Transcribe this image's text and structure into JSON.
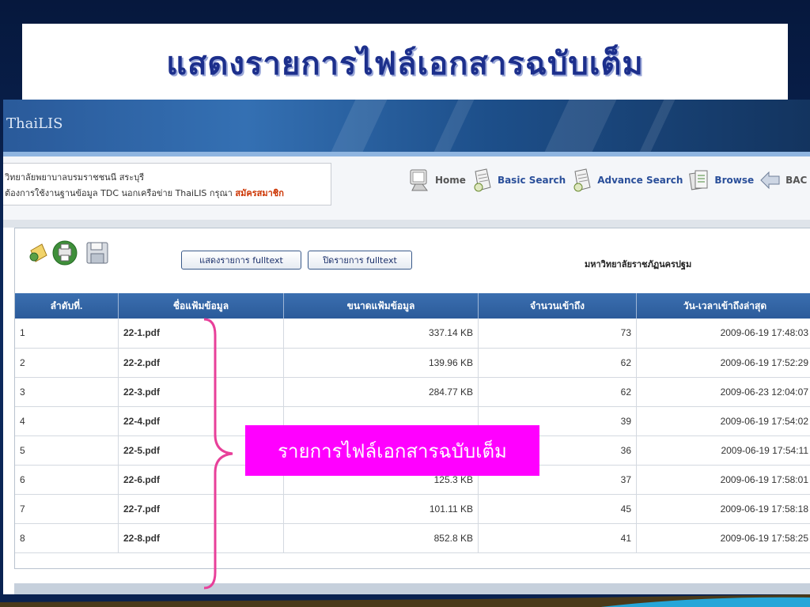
{
  "slide": {
    "title": "แสดงรายการไฟล์เอกสารฉบับเต็ม",
    "callout": "รายการไฟล์เอกสารฉบับเต็ม"
  },
  "app": {
    "brand": "ThaiLIS",
    "institution_line": "วิทยาลัยพยาบาลบรมราชชนนี สระบุรี",
    "notice_prefix": "ต้องการใช้งานฐานข้อมูล TDC นอกเครือข่าย ThaiLIS กรุณา",
    "notice_link": "สมัครสมาชิก",
    "nav": [
      {
        "label": "Home",
        "icon": "monitor-icon"
      },
      {
        "label": "Basic Search",
        "icon": "document-search-icon"
      },
      {
        "label": "Advance Search",
        "icon": "document-search-icon"
      },
      {
        "label": "Browse",
        "icon": "documents-icon"
      },
      {
        "label": "BAC",
        "icon": "back-arrow-icon"
      }
    ]
  },
  "toolbar": {
    "show_fulltext": "แสดงรายการ fulltext",
    "hide_fulltext": "ปิดรายการ fulltext",
    "university": "มหาวิทยาลัยราชภัฏนครปฐม"
  },
  "table": {
    "headers": [
      "ลำดับที่.",
      "ชื่อแฟ้มข้อมูล",
      "ขนาดแฟ้มข้อมูล",
      "จำนวนเข้าถึง",
      "วัน-เวลาเข้าถึงล่าสุด"
    ],
    "rows": [
      {
        "no": "1",
        "name": "22-1.pdf",
        "size": "337.14 KB",
        "hits": "73",
        "date": "2009-06-19 17:48:03"
      },
      {
        "no": "2",
        "name": "22-2.pdf",
        "size": "139.96 KB",
        "hits": "62",
        "date": "2009-06-19 17:52:29"
      },
      {
        "no": "3",
        "name": "22-3.pdf",
        "size": "284.77 KB",
        "hits": "62",
        "date": "2009-06-23 12:04:07"
      },
      {
        "no": "4",
        "name": "22-4.pdf",
        "size": "",
        "hits": "39",
        "date": "2009-06-19 17:54:02"
      },
      {
        "no": "5",
        "name": "22-5.pdf",
        "size": "",
        "hits": "36",
        "date": "2009-06-19 17:54:11"
      },
      {
        "no": "6",
        "name": "22-6.pdf",
        "size": "125.3 KB",
        "hits": "37",
        "date": "2009-06-19 17:58:01"
      },
      {
        "no": "7",
        "name": "22-7.pdf",
        "size": "101.11 KB",
        "hits": "45",
        "date": "2009-06-19 17:58:18"
      },
      {
        "no": "8",
        "name": "22-8.pdf",
        "size": "852.8 KB",
        "hits": "41",
        "date": "2009-06-19 17:58:25"
      }
    ]
  },
  "colors": {
    "title": "#1c2f8c",
    "callout_bg": "#ff00ff",
    "header_bg": "#2b5b9a",
    "file_link": "#e06a00",
    "brace": "#e8409a"
  }
}
